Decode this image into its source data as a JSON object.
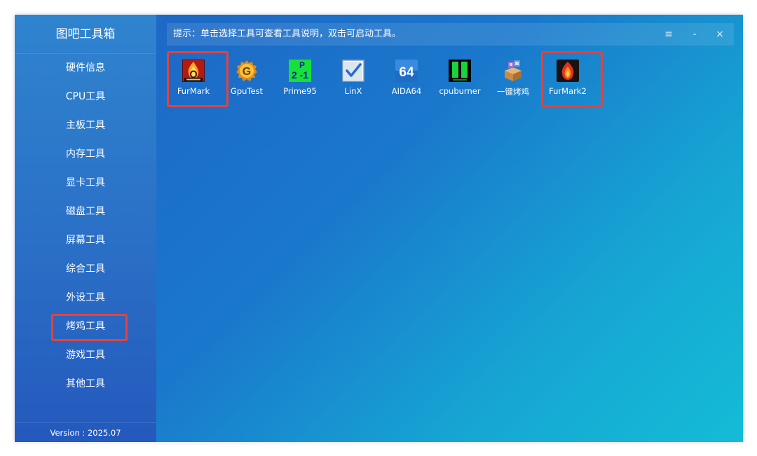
{
  "app": {
    "title": "图吧工具箱",
    "version": "Version : 2025.07"
  },
  "sidebar": {
    "items": [
      {
        "label": "硬件信息",
        "active": false
      },
      {
        "label": "CPU工具",
        "active": false
      },
      {
        "label": "主板工具",
        "active": false
      },
      {
        "label": "内存工具",
        "active": false
      },
      {
        "label": "显卡工具",
        "active": false
      },
      {
        "label": "磁盘工具",
        "active": false
      },
      {
        "label": "屏幕工具",
        "active": false
      },
      {
        "label": "综合工具",
        "active": false
      },
      {
        "label": "外设工具",
        "active": false
      },
      {
        "label": "烤鸡工具",
        "active": true
      },
      {
        "label": "游戏工具",
        "active": false
      },
      {
        "label": "其他工具",
        "active": false
      }
    ]
  },
  "hint": {
    "text": "提示：单击选择工具可查看工具说明，双击可启动工具。"
  },
  "window_controls": {
    "menu": "≡",
    "minimize": "-",
    "close": "×"
  },
  "tools": [
    {
      "label": "FurMark",
      "icon": "furmark-icon",
      "highlighted": true
    },
    {
      "label": "GpuTest",
      "icon": "gputest-icon",
      "highlighted": false
    },
    {
      "label": "Prime95",
      "icon": "prime95-icon",
      "highlighted": false
    },
    {
      "label": "LinX",
      "icon": "linx-icon",
      "highlighted": false
    },
    {
      "label": "AIDA64",
      "icon": "aida64-icon",
      "highlighted": false
    },
    {
      "label": "cpuburner",
      "icon": "cpuburner-icon",
      "highlighted": false
    },
    {
      "label": "一键烤鸡",
      "icon": "one-click-burn-icon",
      "highlighted": false
    },
    {
      "label": "FurMark2",
      "icon": "furmark2-icon",
      "highlighted": true
    }
  ],
  "icon_text": {
    "prime_top": "P",
    "prime_bottom": "2  -1",
    "aida": "64"
  },
  "colors": {
    "highlight": "#e8413a",
    "sidebar": "#2a6fc6",
    "content_start": "#1e63c4",
    "content_end": "#14bcd6"
  }
}
